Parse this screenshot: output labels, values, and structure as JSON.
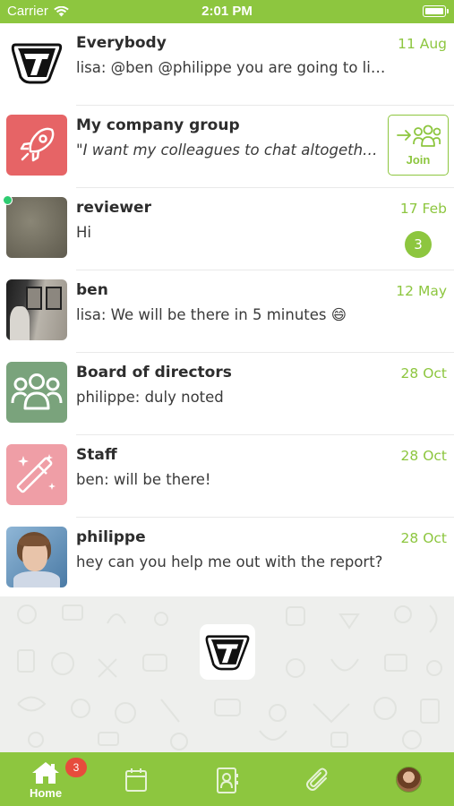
{
  "status_bar": {
    "carrier": "Carrier",
    "time": "2:01 PM"
  },
  "conversations": [
    {
      "name": "Everybody",
      "preview": "lisa: @ben @philippe you are going to lik…",
      "date": "11 Aug",
      "avatar": "seven-logo"
    },
    {
      "name": "My company group",
      "preview": "\"I want my colleagues to chat altogeth…",
      "date": "",
      "avatar": "rocket-icon",
      "action_label": "Join"
    },
    {
      "name": "reviewer",
      "preview": "Hi",
      "date": "17 Feb",
      "unread": "3",
      "online": true,
      "avatar": "photo"
    },
    {
      "name": "ben",
      "preview": "lisa: We will be there in 5 minutes 😄",
      "date": "12 May",
      "avatar": "photo"
    },
    {
      "name": "Board of directors",
      "preview": "philippe: duly noted",
      "date": "28 Oct",
      "avatar": "group-icon"
    },
    {
      "name": "Staff",
      "preview": "ben: will be there!",
      "date": "28 Oct",
      "avatar": "magic-wand-icon"
    },
    {
      "name": "philippe",
      "preview": "hey can you help me out with the report?",
      "date": "28 Oct",
      "avatar": "photo"
    }
  ],
  "tab_bar": {
    "home_label": "Home",
    "home_badge": "3",
    "tabs": [
      "home-icon",
      "calendar-icon",
      "contacts-icon",
      "attachment-icon",
      "profile-avatar"
    ]
  },
  "colors": {
    "accent": "#8dc63f",
    "badge": "#e74c3c",
    "online": "#2ecc71"
  }
}
